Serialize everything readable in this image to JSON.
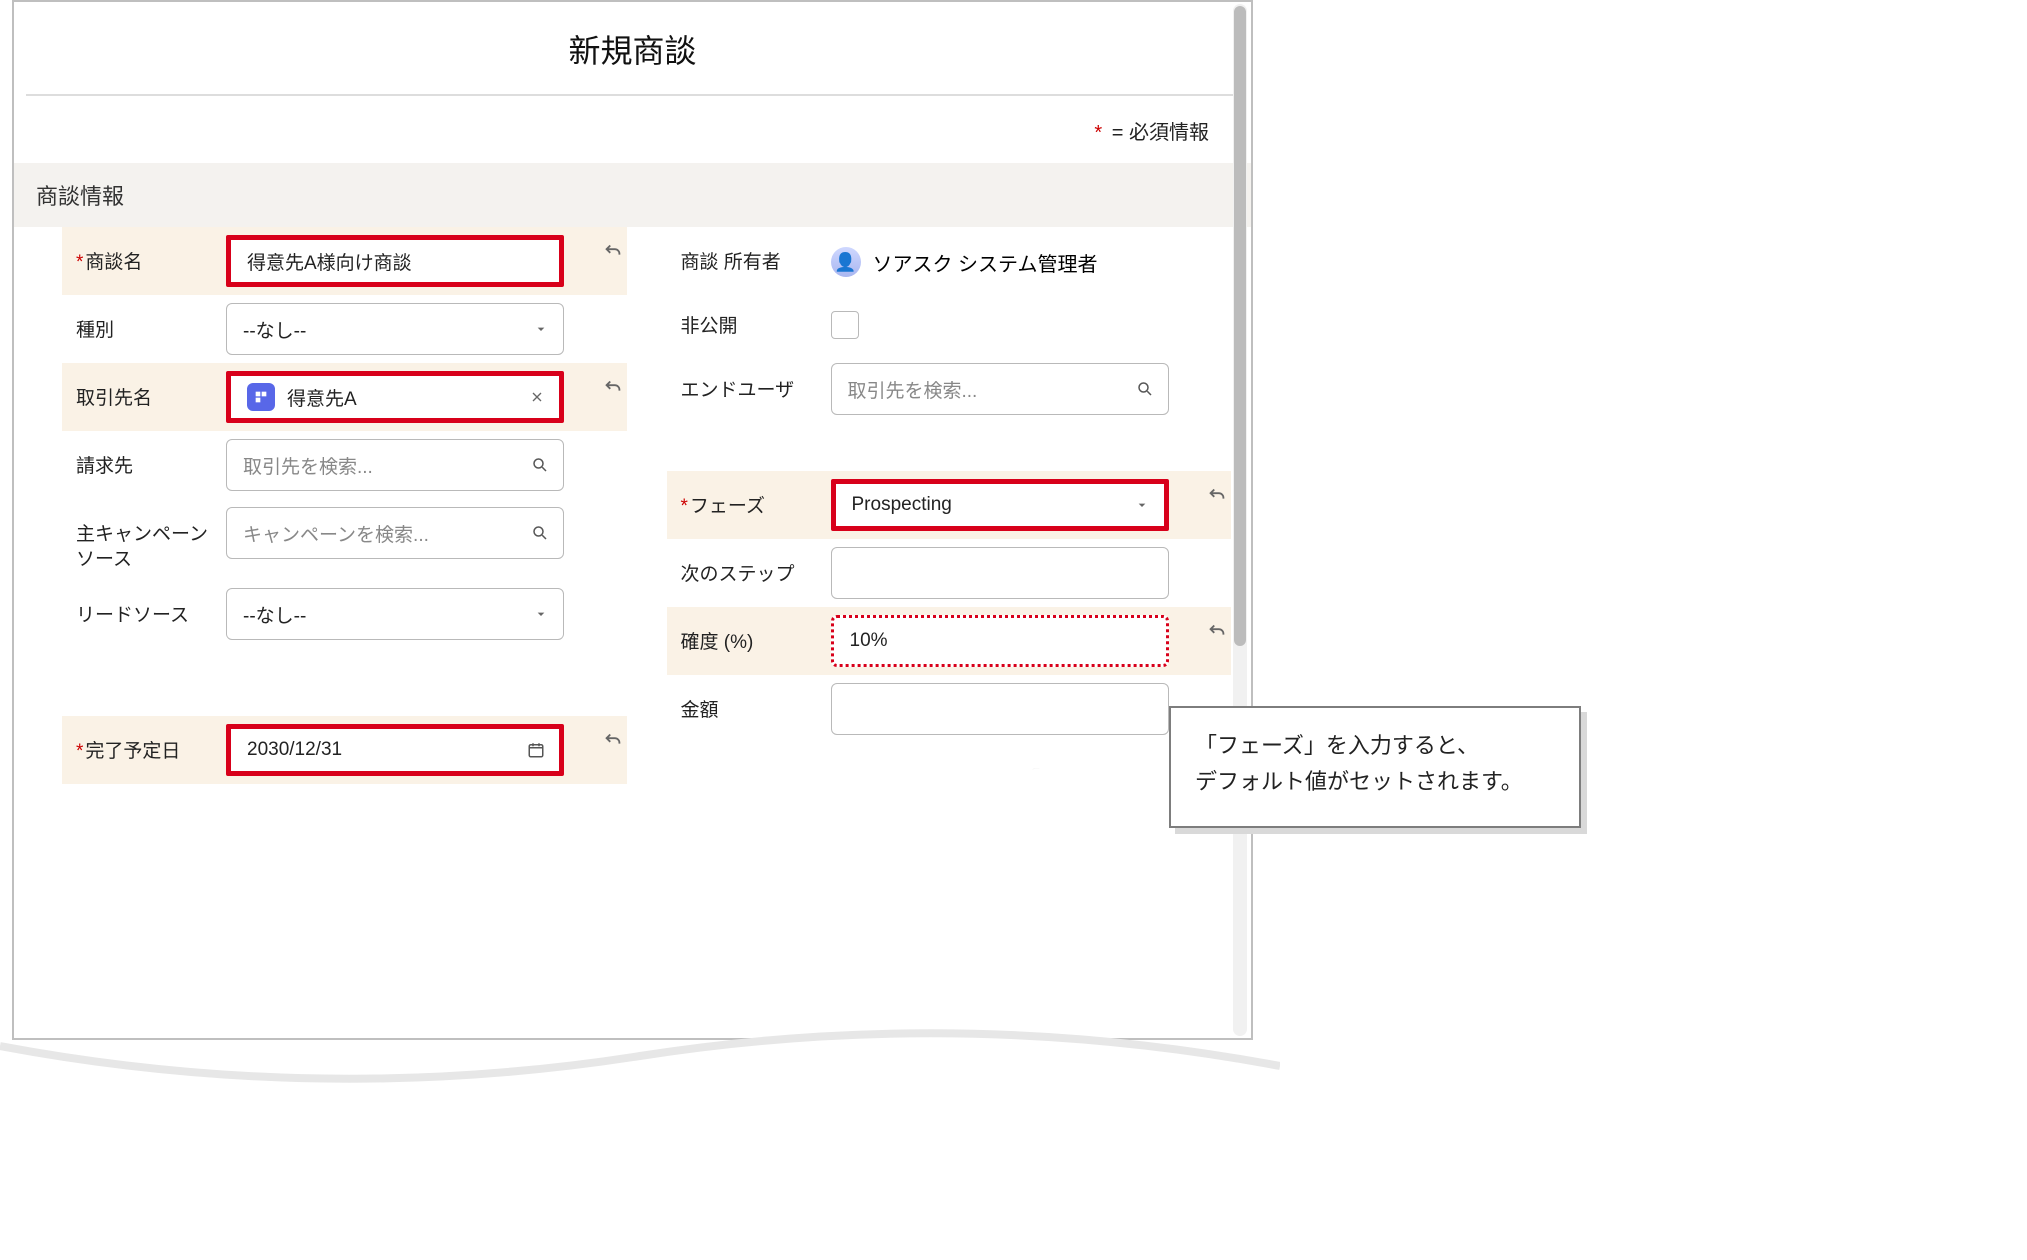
{
  "title": "新規商談",
  "required_note": "= 必須情報",
  "section": "商談情報",
  "left": {
    "opp_name": {
      "label": "商談名",
      "value": "得意先A様向け商談"
    },
    "type": {
      "label": "種別",
      "value": "--なし--"
    },
    "account": {
      "label": "取引先名",
      "value": "得意先A"
    },
    "billing": {
      "label": "請求先",
      "placeholder": "取引先を検索..."
    },
    "campaign": {
      "label": "主キャンペーンソース",
      "placeholder": "キャンペーンを検索..."
    },
    "leadsrc": {
      "label": "リードソース",
      "value": "--なし--"
    },
    "close": {
      "label": "完了予定日",
      "value": "2030/12/31"
    }
  },
  "right": {
    "owner": {
      "label": "商談 所有者",
      "value": "ソアスク システム管理者"
    },
    "private": {
      "label": "非公開"
    },
    "enduser": {
      "label": "エンドユーザ",
      "placeholder": "取引先を検索..."
    },
    "phase": {
      "label": "フェーズ",
      "value": "Prospecting"
    },
    "nextstep": {
      "label": "次のステップ"
    },
    "prob": {
      "label": "確度 (%)",
      "value": "10%"
    },
    "amount": {
      "label": "金額"
    }
  },
  "callout": {
    "line1": "「フェーズ」を入力すると、",
    "line2": "デフォルト値がセットされます。"
  }
}
